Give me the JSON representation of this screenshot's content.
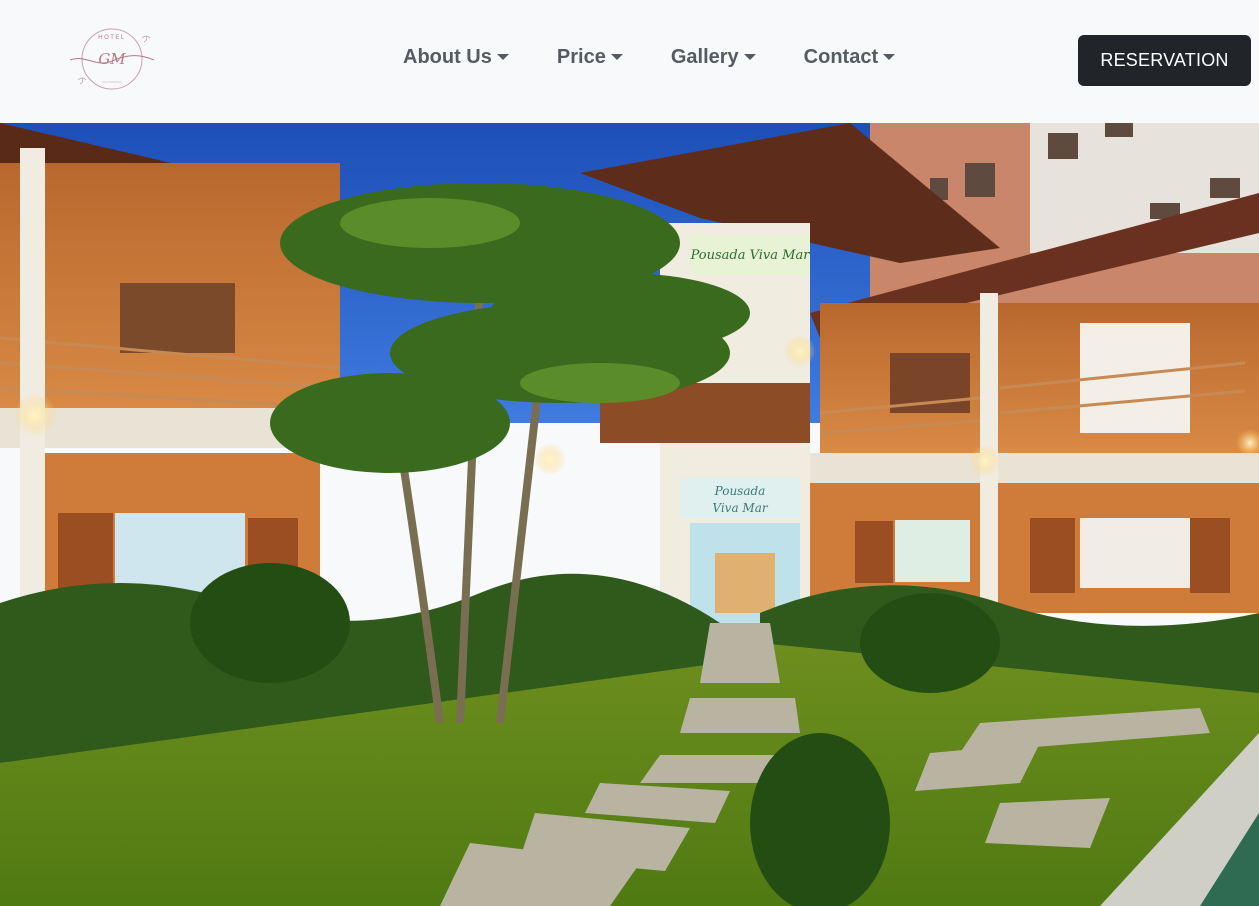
{
  "logo": {
    "top_text": "HOTEL",
    "monogram": "GM",
    "icon": "hotel-logo-emblem"
  },
  "nav": {
    "items": [
      {
        "label": "About Us",
        "icon": "caret-down-icon"
      },
      {
        "label": "Price",
        "icon": "caret-down-icon"
      },
      {
        "label": "Gallery",
        "icon": "caret-down-icon"
      },
      {
        "label": "Contact",
        "icon": "caret-down-icon"
      }
    ]
  },
  "reservation": {
    "label": "RESERVATION"
  },
  "hero": {
    "sign_top": "Pousada Viva Mar",
    "sign_door_line1": "Pousada",
    "sign_door_line2": "Viva Mar"
  },
  "colors": {
    "navbar_bg": "#f8f9fa",
    "nav_text": "#555b62",
    "button_bg": "#212529",
    "button_text": "#ffffff",
    "logo_accent": "#b77a86"
  }
}
